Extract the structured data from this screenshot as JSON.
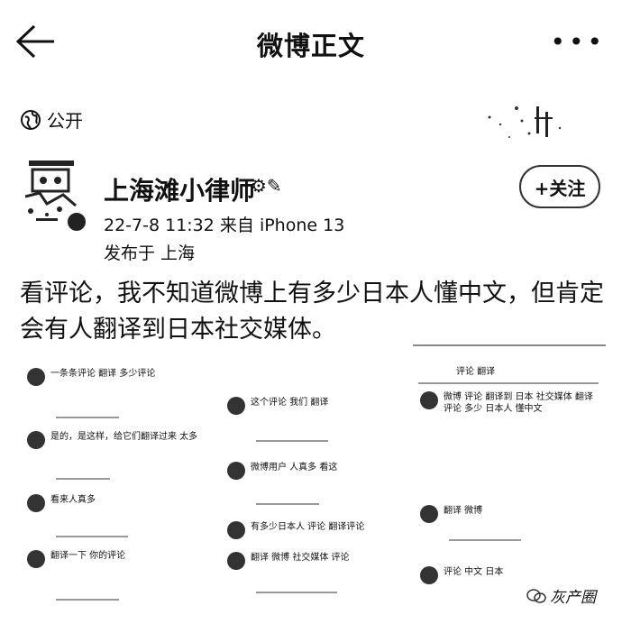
{
  "header": {
    "title": "微博正文",
    "more_label": "•••"
  },
  "post": {
    "visibility": "公开",
    "author": "上海滩小律师",
    "author_icons": "⚙✎",
    "meta": "22-7-8 11:32  来自 iPhone 13",
    "location": "发布于 上海",
    "follow_label": "+关注",
    "text": "看评论，我不知道微博上有多少日本人懂中文，但肯定会有人翻译到日本社交媒体。"
  },
  "screenshots": {
    "left_comments": [
      "一条条评论 翻译 多少评论",
      "是的，是这样，给它们翻译过来 太多",
      "看来人真多",
      "翻译一下 你的评论"
    ],
    "middle_comments": [
      "这个评论 我们 翻译",
      "微博用户 人真多 看这",
      "有多少日本人 评论 翻译评论",
      "翻译 微博 社交媒体 评论"
    ],
    "right_header": "评论 翻译",
    "right_comments": [
      "微博 评论 翻译到 日本 社交媒体 翻译 评论 多少 日本人 懂中文",
      "翻译 微博",
      "评论 中文 日本"
    ]
  },
  "watermark": {
    "text": "灰产圈"
  }
}
